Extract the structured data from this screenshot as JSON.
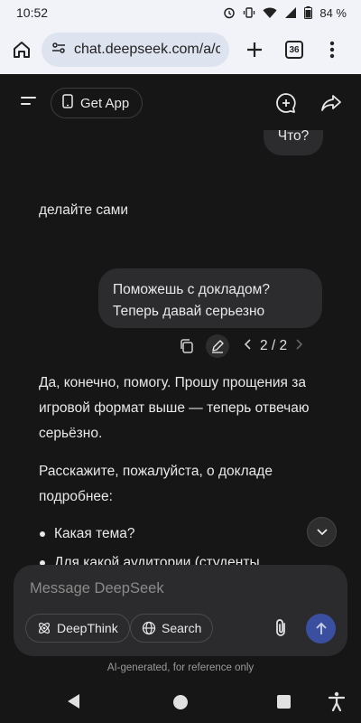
{
  "status_bar": {
    "time": "10:52",
    "battery": "84 %"
  },
  "browser": {
    "url": "chat.deepseek.com/a/ch",
    "tab_count": "36"
  },
  "header": {
    "get_app_label": "Get App"
  },
  "chat": {
    "user_prev_message": "Что?",
    "ai_prev_reply": "делайте сами",
    "user_message_line1": "Поможешь с докладом?",
    "user_message_line2": "Теперь давай серьезно",
    "pager": "2 / 2",
    "ai_para1": "Да, конечно, помогу. Прошу прощения за игровой формат выше — теперь отвечаю серьёзно.",
    "ai_para2": "Расскажите, пожалуйста, о докладе подробнее:",
    "bullets": [
      "Какая тема?",
      "Для какой аудитории (студенты,"
    ]
  },
  "composer": {
    "placeholder": "Message DeepSeek",
    "deepthink_label": "DeepThink",
    "search_label": "Search"
  },
  "disclaimer": "AI-generated, for reference only",
  "colors": {
    "send_button": "#3b4fa0",
    "background": "#161616",
    "bubble": "#2c2c2e"
  }
}
